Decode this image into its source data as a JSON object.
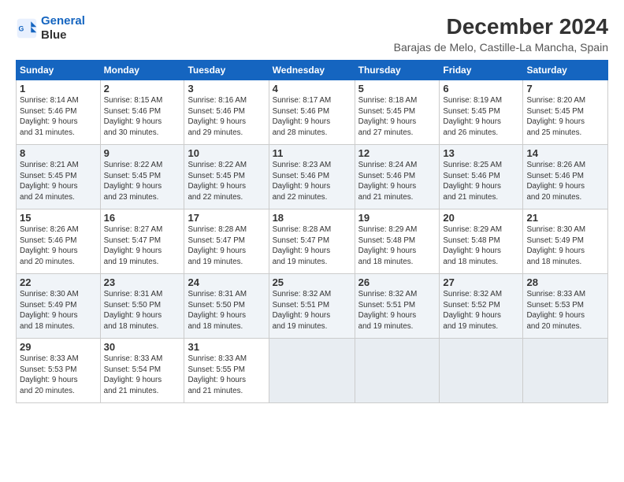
{
  "logo": {
    "line1": "General",
    "line2": "Blue"
  },
  "title": "December 2024",
  "subtitle": "Barajas de Melo, Castille-La Mancha, Spain",
  "days_of_week": [
    "Sunday",
    "Monday",
    "Tuesday",
    "Wednesday",
    "Thursday",
    "Friday",
    "Saturday"
  ],
  "weeks": [
    [
      {
        "day": "1",
        "info": "Sunrise: 8:14 AM\nSunset: 5:46 PM\nDaylight: 9 hours\nand 31 minutes."
      },
      {
        "day": "2",
        "info": "Sunrise: 8:15 AM\nSunset: 5:46 PM\nDaylight: 9 hours\nand 30 minutes."
      },
      {
        "day": "3",
        "info": "Sunrise: 8:16 AM\nSunset: 5:46 PM\nDaylight: 9 hours\nand 29 minutes."
      },
      {
        "day": "4",
        "info": "Sunrise: 8:17 AM\nSunset: 5:46 PM\nDaylight: 9 hours\nand 28 minutes."
      },
      {
        "day": "5",
        "info": "Sunrise: 8:18 AM\nSunset: 5:45 PM\nDaylight: 9 hours\nand 27 minutes."
      },
      {
        "day": "6",
        "info": "Sunrise: 8:19 AM\nSunset: 5:45 PM\nDaylight: 9 hours\nand 26 minutes."
      },
      {
        "day": "7",
        "info": "Sunrise: 8:20 AM\nSunset: 5:45 PM\nDaylight: 9 hours\nand 25 minutes."
      }
    ],
    [
      {
        "day": "8",
        "info": "Sunrise: 8:21 AM\nSunset: 5:45 PM\nDaylight: 9 hours\nand 24 minutes."
      },
      {
        "day": "9",
        "info": "Sunrise: 8:22 AM\nSunset: 5:45 PM\nDaylight: 9 hours\nand 23 minutes."
      },
      {
        "day": "10",
        "info": "Sunrise: 8:22 AM\nSunset: 5:45 PM\nDaylight: 9 hours\nand 22 minutes."
      },
      {
        "day": "11",
        "info": "Sunrise: 8:23 AM\nSunset: 5:46 PM\nDaylight: 9 hours\nand 22 minutes."
      },
      {
        "day": "12",
        "info": "Sunrise: 8:24 AM\nSunset: 5:46 PM\nDaylight: 9 hours\nand 21 minutes."
      },
      {
        "day": "13",
        "info": "Sunrise: 8:25 AM\nSunset: 5:46 PM\nDaylight: 9 hours\nand 21 minutes."
      },
      {
        "day": "14",
        "info": "Sunrise: 8:26 AM\nSunset: 5:46 PM\nDaylight: 9 hours\nand 20 minutes."
      }
    ],
    [
      {
        "day": "15",
        "info": "Sunrise: 8:26 AM\nSunset: 5:46 PM\nDaylight: 9 hours\nand 20 minutes."
      },
      {
        "day": "16",
        "info": "Sunrise: 8:27 AM\nSunset: 5:47 PM\nDaylight: 9 hours\nand 19 minutes."
      },
      {
        "day": "17",
        "info": "Sunrise: 8:28 AM\nSunset: 5:47 PM\nDaylight: 9 hours\nand 19 minutes."
      },
      {
        "day": "18",
        "info": "Sunrise: 8:28 AM\nSunset: 5:47 PM\nDaylight: 9 hours\nand 19 minutes."
      },
      {
        "day": "19",
        "info": "Sunrise: 8:29 AM\nSunset: 5:48 PM\nDaylight: 9 hours\nand 18 minutes."
      },
      {
        "day": "20",
        "info": "Sunrise: 8:29 AM\nSunset: 5:48 PM\nDaylight: 9 hours\nand 18 minutes."
      },
      {
        "day": "21",
        "info": "Sunrise: 8:30 AM\nSunset: 5:49 PM\nDaylight: 9 hours\nand 18 minutes."
      }
    ],
    [
      {
        "day": "22",
        "info": "Sunrise: 8:30 AM\nSunset: 5:49 PM\nDaylight: 9 hours\nand 18 minutes."
      },
      {
        "day": "23",
        "info": "Sunrise: 8:31 AM\nSunset: 5:50 PM\nDaylight: 9 hours\nand 18 minutes."
      },
      {
        "day": "24",
        "info": "Sunrise: 8:31 AM\nSunset: 5:50 PM\nDaylight: 9 hours\nand 18 minutes."
      },
      {
        "day": "25",
        "info": "Sunrise: 8:32 AM\nSunset: 5:51 PM\nDaylight: 9 hours\nand 19 minutes."
      },
      {
        "day": "26",
        "info": "Sunrise: 8:32 AM\nSunset: 5:51 PM\nDaylight: 9 hours\nand 19 minutes."
      },
      {
        "day": "27",
        "info": "Sunrise: 8:32 AM\nSunset: 5:52 PM\nDaylight: 9 hours\nand 19 minutes."
      },
      {
        "day": "28",
        "info": "Sunrise: 8:33 AM\nSunset: 5:53 PM\nDaylight: 9 hours\nand 20 minutes."
      }
    ],
    [
      {
        "day": "29",
        "info": "Sunrise: 8:33 AM\nSunset: 5:53 PM\nDaylight: 9 hours\nand 20 minutes."
      },
      {
        "day": "30",
        "info": "Sunrise: 8:33 AM\nSunset: 5:54 PM\nDaylight: 9 hours\nand 21 minutes."
      },
      {
        "day": "31",
        "info": "Sunrise: 8:33 AM\nSunset: 5:55 PM\nDaylight: 9 hours\nand 21 minutes."
      },
      null,
      null,
      null,
      null
    ]
  ]
}
